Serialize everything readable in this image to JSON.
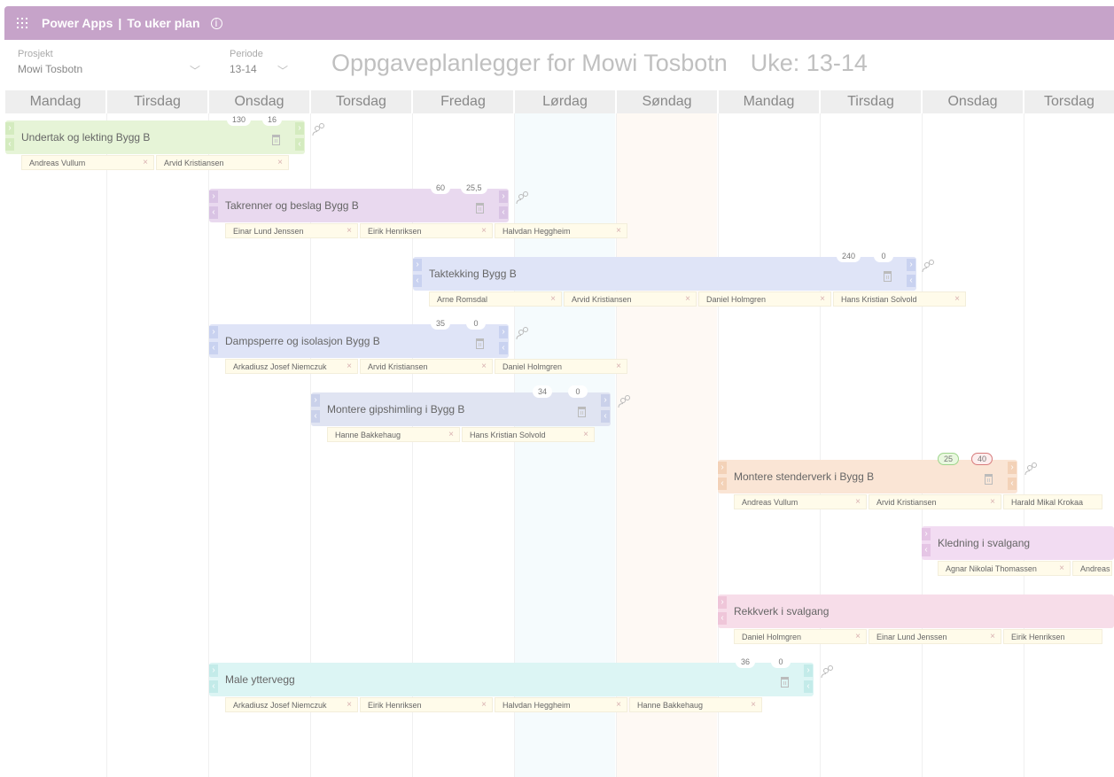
{
  "app": {
    "brand": "Power Apps",
    "separator": "|",
    "screen_title": "To uker plan",
    "info_icon": "info-icon",
    "waffle_icon": "waffle-icon"
  },
  "filters": {
    "project": {
      "label": "Prosjekt",
      "value": "Mowi Tosbotn"
    },
    "period": {
      "label": "Periode",
      "value": "13-14"
    }
  },
  "headline": {
    "text": "Oppgaveplanlegger for Mowi Tosbotn",
    "week": "Uke: 13-14"
  },
  "days": [
    "Mandag",
    "Tirsdag",
    "Onsdag",
    "Torsdag",
    "Fredag",
    "Lørdag",
    "Søndag",
    "Mandag",
    "Tirsdag",
    "Onsdag",
    "Torsdag"
  ],
  "tasks": [
    {
      "title": "Undertak og lekting Bygg B",
      "color": "#e6f4d7",
      "hours": "130",
      "progress": "16",
      "assignees": [
        "Andreas Vullum",
        "Arvid Kristiansen"
      ]
    },
    {
      "title": "Takrenner og beslag Bygg B",
      "color": "#e9d9ef",
      "hours": "60",
      "progress": "25,5",
      "assignees": [
        "Einar Lund Jenssen",
        "Eirik Henriksen",
        "Halvdan Heggheim"
      ]
    },
    {
      "title": "Taktekking Bygg B",
      "color": "#dfe4f7",
      "hours": "240",
      "progress": "0",
      "assignees": [
        "Arne Romsdal",
        "Arvid Kristiansen",
        "Daniel Holmgren",
        "Hans Kristian Solvold"
      ]
    },
    {
      "title": "Dampsperre og isolasjon Bygg B",
      "color": "#dfe4f7",
      "hours": "35",
      "progress": "0",
      "assignees": [
        "Arkadiusz Josef Niemczuk",
        "Arvid Kristiansen",
        "Daniel Holmgren"
      ]
    },
    {
      "title": "Montere gipshimling i Bygg B",
      "color": "#e0e4f2",
      "hours": "34",
      "progress": "0",
      "assignees": [
        "Hanne Bakkehaug",
        "Hans Kristian Solvold"
      ]
    },
    {
      "title": "Montere stenderverk i Bygg B",
      "color": "#fae5d5",
      "hours": "25",
      "progress": "40",
      "assignees": [
        "Andreas Vullum",
        "Arvid Kristiansen",
        "Harald Mikal Krokaa"
      ]
    },
    {
      "title": "Kledning i svalgang",
      "color": "#f2dcf2",
      "assignees": [
        "Agnar Nikolai Thomassen",
        "Andreas Vullum"
      ]
    },
    {
      "title": "Rekkverk i svalgang",
      "color": "#f7dde9",
      "assignees": [
        "Daniel Holmgren",
        "Einar Lund Jenssen",
        "Eirik Henriksen"
      ]
    },
    {
      "title": "Male yttervegg",
      "color": "#dcf5f4",
      "hours": "36",
      "progress": "0",
      "assignees": [
        "Arkadiusz Josef Niemczuk",
        "Eirik Henriksen",
        "Halvdan Heggheim",
        "Hanne Bakkehaug"
      ]
    }
  ]
}
